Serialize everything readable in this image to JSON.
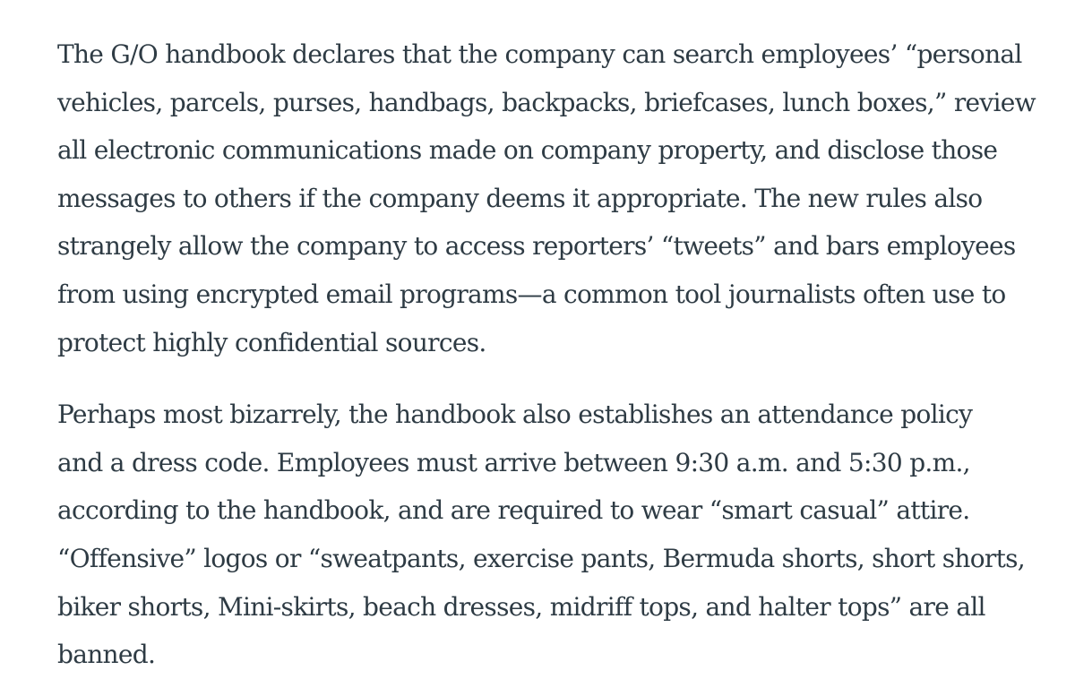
{
  "article": {
    "paragraphs": [
      {
        "lines": [
          "The G/O handbook declares that the company can search employees’ “personal",
          "vehicles, parcels, purses, handbags, backpacks, briefcases, lunch boxes,” review",
          "all electronic communications made on company property, and disclose those",
          "messages to others if the company deems it appropriate. The new rules also",
          "strangely allow the company to access reporters’ “tweets” and bars employees",
          "from using encrypted email programs—a common tool journalists often use to",
          "protect highly confidential sources."
        ]
      },
      {
        "lines": [
          "Perhaps most bizarrely, the handbook also establishes an attendance policy",
          "and a dress code. Employees must arrive between 9:30 a.m. and 5:30 p.m.,",
          "according to the handbook, and are required to wear “smart casual” attire.",
          "“Offensive” logos or “sweatpants, exercise pants, Bermuda shorts, short shorts,",
          "biker shorts, Mini-skirts, beach dresses, midriff tops, and halter tops” are all",
          "banned."
        ]
      }
    ]
  }
}
